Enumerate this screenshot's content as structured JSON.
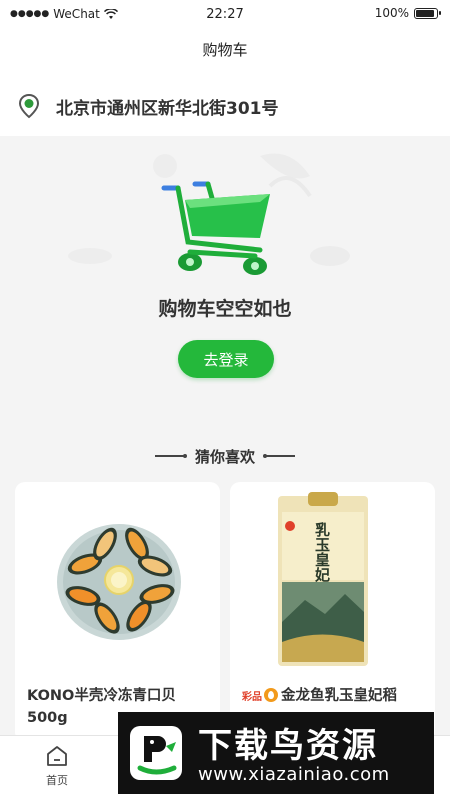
{
  "status_bar": {
    "carrier": "WeChat",
    "time": "22:27",
    "battery": "100%",
    "battery_level": 1.0
  },
  "nav": {
    "title": "购物车"
  },
  "address": {
    "text": "北京市通州区新华北街301号",
    "icon": "location-pin-icon",
    "icon_color": "#2d9a3a"
  },
  "empty_cart": {
    "message": "购物车空空如也",
    "login_label": "去登录",
    "accent_color": "#24b83b",
    "icon": "shopping-cart-icon"
  },
  "recommend": {
    "title": "猜你喜欢",
    "products": [
      {
        "title": "KONO半壳冷冻青口贝500g",
        "image": "mussels-plate-image"
      },
      {
        "brand_tag": "彩品",
        "title": "金龙鱼乳玉皇妃稻",
        "image": "rice-bag-image",
        "package_text": "乳玉皇妃"
      }
    ]
  },
  "tab_bar": {
    "items": [
      {
        "label": "首页",
        "icon": "home-icon"
      }
    ]
  },
  "watermark": {
    "title": "下载鸟资源",
    "url": "www.xiazainiao.com"
  }
}
